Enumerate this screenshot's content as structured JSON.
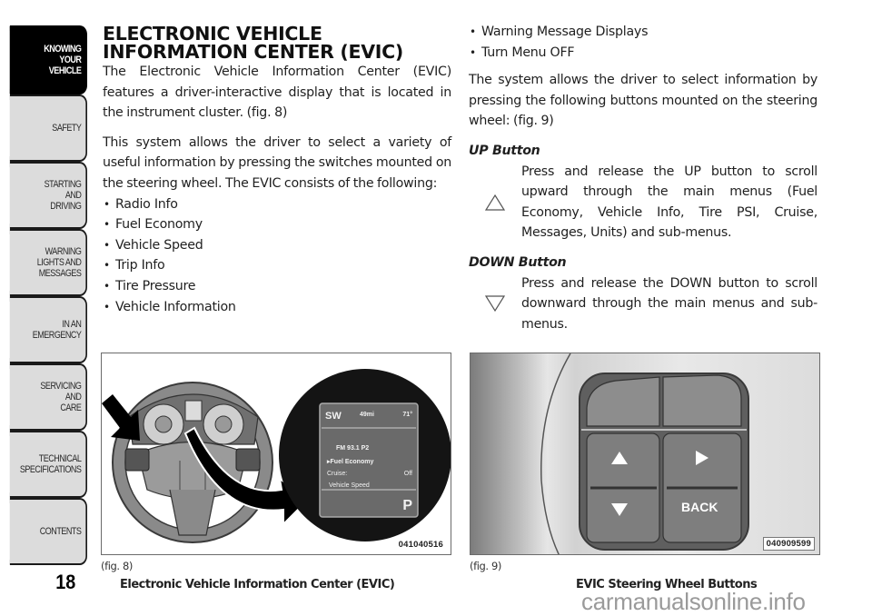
{
  "sidebar": {
    "tabs": [
      {
        "lines": [
          "KNOWING",
          "YOUR",
          "VEHICLE"
        ],
        "active": true
      },
      {
        "lines": [
          "SAFETY"
        ]
      },
      {
        "lines": [
          "STARTING",
          "AND",
          "DRIVING"
        ]
      },
      {
        "lines": [
          "WARNING",
          "LIGHTS AND",
          "MESSAGES"
        ]
      },
      {
        "lines": [
          "IN AN",
          "EMERGENCY"
        ]
      },
      {
        "lines": [
          "SERVICING",
          "AND",
          "CARE"
        ]
      },
      {
        "lines": [
          "TECHNICAL",
          "SPECIFICATIONS"
        ]
      },
      {
        "lines": [
          "CONTENTS"
        ]
      }
    ]
  },
  "page_number": "18",
  "section": {
    "title_line1": "ELECTRONIC VEHICLE",
    "title_line2": "INFORMATION CENTER (EVIC)",
    "intro": "The Electronic Vehicle Information Center (EVIC) features a driver-interactive display that is located in the instrument cluster. (fig.  8)",
    "intro2": "This system allows the driver to select a variety of useful information by pressing the switches mounted on the steering wheel. The EVIC consists of the following:",
    "features": [
      "Radio Info",
      "Fuel Economy",
      "Vehicle Speed",
      "Trip Info",
      "Tire Pressure",
      "Vehicle Information"
    ],
    "features_cont": [
      "Warning Message Displays",
      "Turn Menu OFF"
    ],
    "buttons_intro": "The system allows the driver to select information by pressing the following buttons mounted on the steering wheel: (fig.  9)",
    "up_button": {
      "heading": "UP Button",
      "icon": "up-triangle-outline-icon",
      "text": "Press and release the UP button to scroll upward through the main menus (Fuel Economy, Vehicle Info, Tire PSI, Cruise, Messages, Units) and sub-menus."
    },
    "down_button": {
      "heading": "DOWN Button",
      "icon": "down-triangle-outline-icon",
      "text": "Press and release the DOWN button to scroll downward through the main menus and sub-menus."
    }
  },
  "figures": {
    "fig8": {
      "ref": "(fig. 8)",
      "caption": "Electronic Vehicle Information Center (EVIC)",
      "code": "041040516",
      "display": {
        "compass": "SW",
        "range": "49mi",
        "temp": "71°",
        "radio": "FM 93.1 P2",
        "selected": "▸Fuel Economy",
        "cruise_label": "Cruise:",
        "cruise_value": "Off",
        "item": "Vehicle Speed",
        "gear": "P"
      }
    },
    "fig9": {
      "ref": "(fig. 9)",
      "caption": "EVIC Steering Wheel Buttons",
      "code": "040909599",
      "back_label": "BACK"
    }
  },
  "watermark": "carmanualsonline.info"
}
